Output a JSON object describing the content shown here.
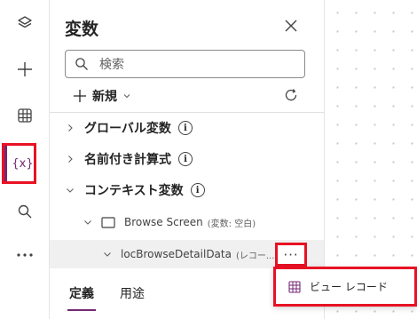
{
  "rail": {
    "items": [
      {
        "name": "tree-view",
        "icon": "layers-icon"
      },
      {
        "name": "insert",
        "icon": "plus-icon"
      },
      {
        "name": "data",
        "icon": "table-icon"
      },
      {
        "name": "variables",
        "icon": "variables-icon",
        "glyph": "{x}",
        "active": true
      },
      {
        "name": "search",
        "icon": "search-icon"
      },
      {
        "name": "more",
        "icon": "more-icon"
      }
    ]
  },
  "panel": {
    "title": "変数",
    "search_placeholder": "検索",
    "new_label": "新規",
    "sections": [
      {
        "label": "グローバル変数",
        "expanded": false
      },
      {
        "label": "名前付き計算式",
        "expanded": false
      },
      {
        "label": "コンテキスト変数",
        "expanded": true
      }
    ],
    "screen": {
      "label": "Browse Screen",
      "note": "(変数: 空白)"
    },
    "variable": {
      "label": "locBrowseDetailData",
      "note": "(レコー...",
      "more": "···"
    },
    "tabs": [
      {
        "label": "定義",
        "active": true
      },
      {
        "label": "用途",
        "active": false
      }
    ]
  },
  "context_menu": {
    "item_label": "ビュー レコード",
    "item_icon": "table-icon"
  },
  "colors": {
    "accent": "#742774",
    "highlight_border": "#e81123"
  }
}
